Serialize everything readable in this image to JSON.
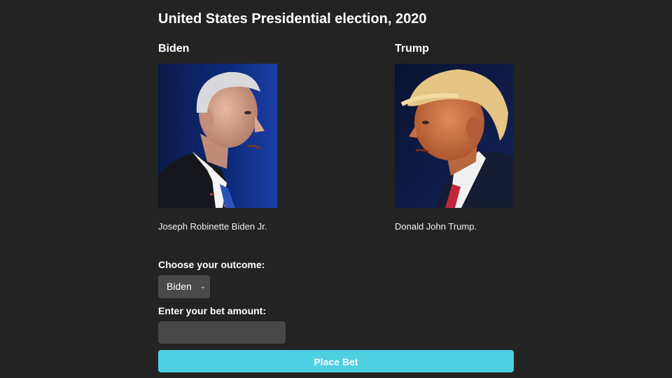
{
  "title": "United States Presidential election, 2020",
  "candidates": [
    {
      "short_name": "Biden",
      "full_name": "Joseph Robinette Biden Jr.",
      "photo_icon": "biden-portrait"
    },
    {
      "short_name": "Trump",
      "full_name": "Donald John Trump.",
      "photo_icon": "trump-portrait"
    }
  ],
  "form": {
    "outcome_label": "Choose your outcome:",
    "outcome_selected": "Biden",
    "amount_label": "Enter your bet amount:",
    "amount_value": "",
    "amount_placeholder": "",
    "submit_label": "Place Bet"
  },
  "colors": {
    "background": "#232323",
    "button": "#4dd0e1",
    "input": "#474747"
  }
}
